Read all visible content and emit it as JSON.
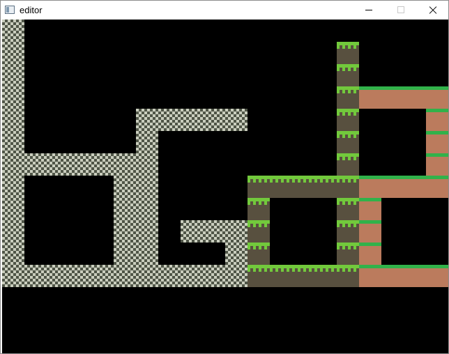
{
  "window": {
    "title": "editor",
    "controls": [
      "minimize",
      "maximize",
      "close"
    ]
  },
  "game": {
    "tile_types": [
      "stone",
      "grass-dirt",
      "grass-clay"
    ],
    "colors": {
      "background": "#000000",
      "stone_light": "#c9cdbd",
      "stone_dark": "#4f5547",
      "grass_bright": "#72c93c",
      "dirt": "#58503f",
      "grass_clay_top": "#31b24a",
      "clay": "#bb7b5d"
    }
  }
}
